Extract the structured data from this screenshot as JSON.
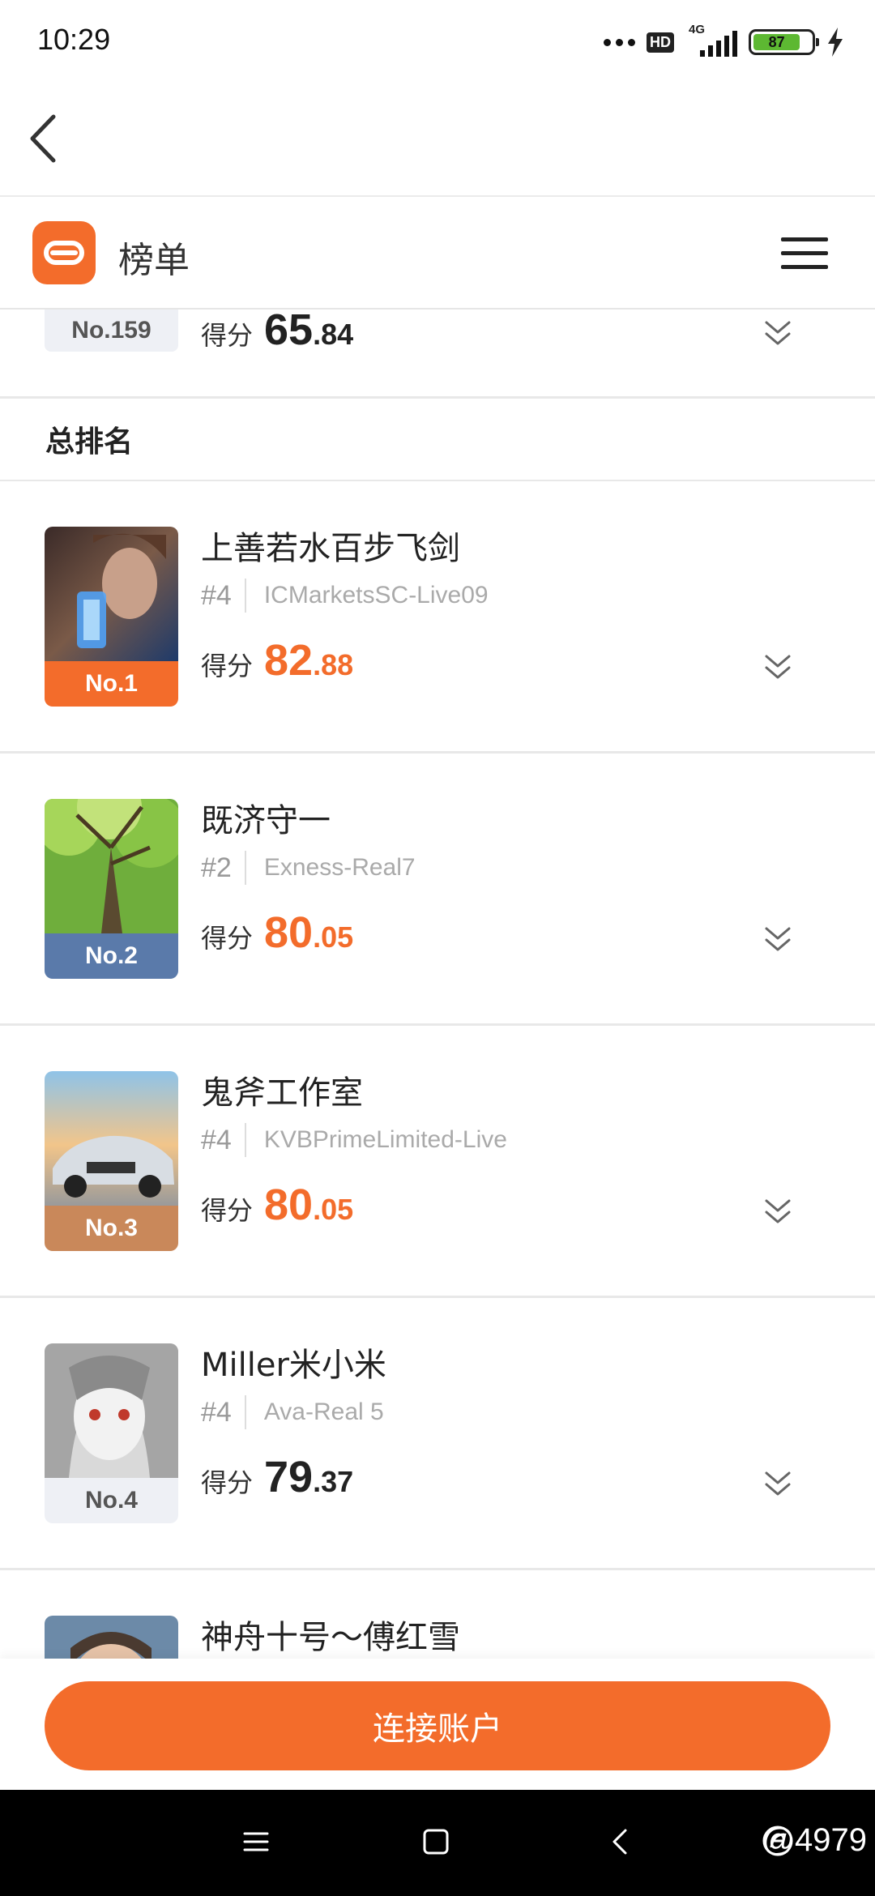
{
  "status_bar": {
    "time": "10:29",
    "hd_label": "HD",
    "network": "4G",
    "battery": "87"
  },
  "header": {
    "title": "榜单"
  },
  "partial_entry": {
    "rank_badge": "No.159",
    "score_label": "得分",
    "score_int": "65",
    "score_dec": ".84"
  },
  "section": {
    "title": "总排名"
  },
  "ranking": [
    {
      "name": "上善若水百步飞剑",
      "num": "#4",
      "server": "ICMarketsSC-Live09",
      "rank": "No.1",
      "badge_color": "#f36c2b",
      "score_label": "得分",
      "score_int": "82",
      "score_dec": ".88",
      "score_color": "orange"
    },
    {
      "name": "既济守一",
      "num": "#2",
      "server": "Exness-Real7",
      "rank": "No.2",
      "badge_color": "#5a7aaa",
      "score_label": "得分",
      "score_int": "80",
      "score_dec": ".05",
      "score_color": "orange"
    },
    {
      "name": "鬼斧工作室",
      "num": "#4",
      "server": "KVBPrimeLimited-Live",
      "rank": "No.3",
      "badge_color": "#c9885a",
      "score_label": "得分",
      "score_int": "80",
      "score_dec": ".05",
      "score_color": "orange"
    },
    {
      "name": "Miller米小米",
      "num": "#4",
      "server": "Ava-Real 5",
      "rank": "No.4",
      "badge_color": "#eef0f5",
      "score_label": "得分",
      "score_int": "79",
      "score_dec": ".37",
      "score_color": "dark"
    },
    {
      "name": "神舟十号～傅红雪",
      "num": "",
      "server": "",
      "rank": "",
      "badge_color": "",
      "score_label": "",
      "score_int": "",
      "score_dec": "",
      "score_color": ""
    }
  ],
  "bottom": {
    "connect_label": "连接账户"
  },
  "watermark": "@4979"
}
